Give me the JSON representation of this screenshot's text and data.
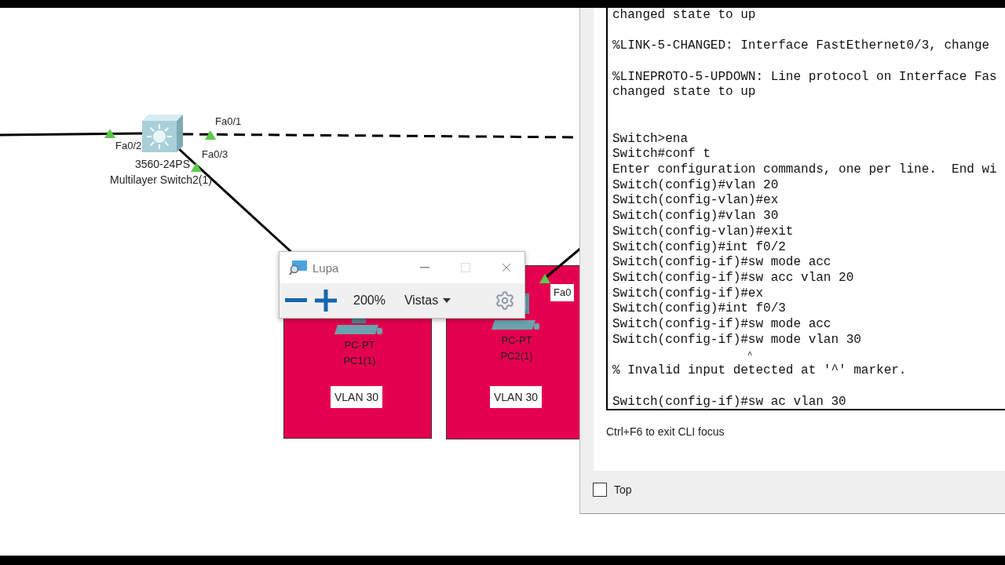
{
  "canvas": {
    "devices": [
      {
        "kind": "switch",
        "model": "3560-24PS",
        "name": "Multilayer Switch2(1)"
      },
      {
        "kind": "pc",
        "model": "PC-PT",
        "name": "PC1(1)"
      },
      {
        "kind": "pc",
        "model": "PC-PT",
        "name": "PC2(1)"
      }
    ],
    "links": [
      {
        "kind": "straight"
      },
      {
        "kind": "crossover"
      },
      {
        "kind": "straight"
      },
      {
        "kind": "straight"
      }
    ],
    "port_labels": [
      {
        "text": "Fa0/2",
        "kind": "plain"
      },
      {
        "text": "Fa0/1",
        "kind": "plain"
      },
      {
        "text": "Fa0/3",
        "kind": "plain"
      },
      {
        "text": "Fa0",
        "kind": "boxed"
      }
    ],
    "areas": [
      {
        "note": "VLAN 30"
      },
      {
        "note": "VLAN 30"
      }
    ]
  },
  "magnifier": {
    "title": "Lupa",
    "zoom": "200%",
    "views_menu": "Vistas"
  },
  "console": {
    "lines": [
      {
        "text": "changed state to up"
      },
      {
        "text": "%LINK-5-CHANGED: Interface FastEthernet0/3, change",
        "kind": "after_gap"
      },
      {
        "text": "%LINEPROTO-5-UPDOWN: Line protocol on Interface Fas",
        "kind": "after_gap"
      },
      {
        "text": "changed state to up"
      },
      {
        "text": "Switch>ena",
        "kind": "after_double_gap"
      },
      {
        "text": "Switch#conf t"
      },
      {
        "text": "Enter configuration commands, one per line.  End wi"
      },
      {
        "text": "Switch(config)#vlan 20"
      },
      {
        "text": "Switch(config-vlan)#ex"
      },
      {
        "text": "Switch(config)#vlan 30"
      },
      {
        "text": "Switch(config-vlan)#exit"
      },
      {
        "text": "Switch(config)#int f0/2"
      },
      {
        "text": "Switch(config-if)#sw mode acc"
      },
      {
        "text": "Switch(config-if)#sw acc vlan 20"
      },
      {
        "text": "Switch(config-if)#ex"
      },
      {
        "text": "Switch(config)#int f0/3"
      },
      {
        "text": "Switch(config-if)#sw mode acc"
      },
      {
        "text": "Switch(config-if)#sw mode vlan 30"
      },
      {
        "text": "                          ^",
        "kind": "marker"
      },
      {
        "text": "% Invalid input detected at '^' marker."
      },
      {
        "text": "Switch(config-if)#sw ac vlan 30",
        "kind": "after_gap"
      }
    ],
    "hint": "Ctrl+F6 to exit CLI focus"
  },
  "top_checkbox": {
    "label": "Top",
    "checked": false
  }
}
